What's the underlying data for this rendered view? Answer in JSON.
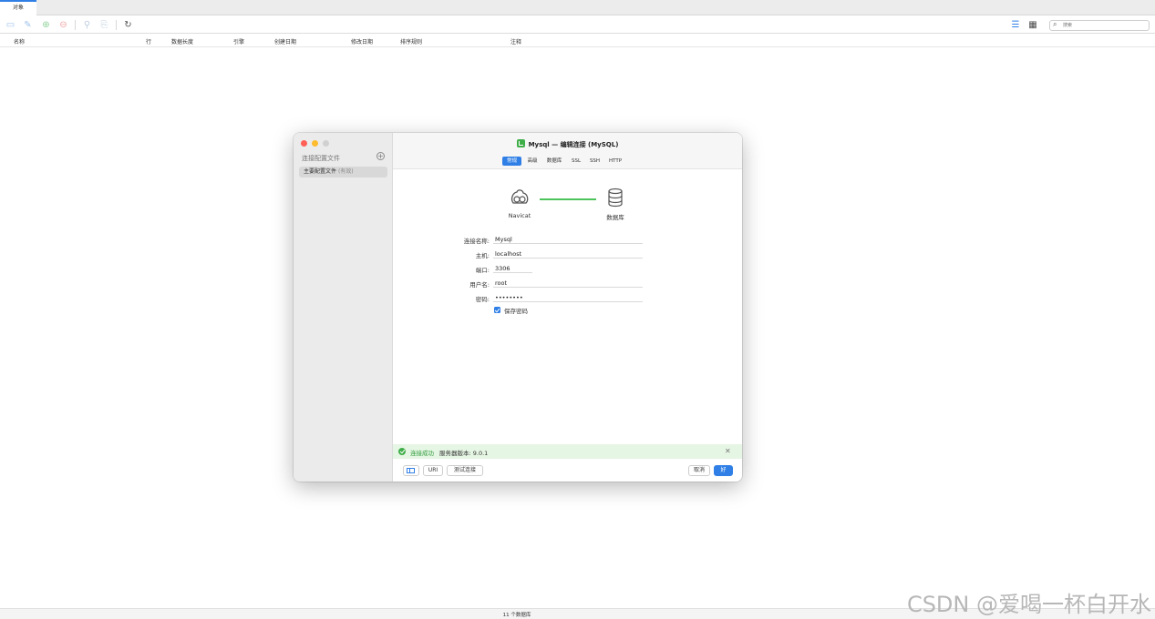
{
  "tabs": [
    {
      "label": "对象"
    }
  ],
  "columns": [
    "名称",
    "行",
    "数据长度",
    "引擎",
    "创建日期",
    "修改日期",
    "排序规则",
    "注释"
  ],
  "search": {
    "placeholder": "搜索"
  },
  "status": {
    "text": "11 个数据库"
  },
  "watermark": "CSDN @爱喝一杯白开水",
  "dialog": {
    "title": "Mysql — 编辑连接 (MySQL)",
    "sidebar": {
      "heading": "连接配置文件",
      "item_label": "主要配置文件",
      "item_tag": "(有效)"
    },
    "segments": [
      "常规",
      "高级",
      "数据库",
      "SSL",
      "SSH",
      "HTTP"
    ],
    "active_segment": "常规",
    "diagram": {
      "left_label": "Navicat",
      "right_label": "数据库"
    },
    "form": {
      "connection_name_label": "连接名称:",
      "connection_name": "Mysql",
      "host_label": "主机:",
      "host": "localhost",
      "port_label": "端口:",
      "port": "3306",
      "user_label": "用户名:",
      "user": "root",
      "password_label": "密码:",
      "password": "••••••••",
      "save_password_label": "保存密码",
      "save_password": true
    },
    "result": {
      "status": "连接成功",
      "version": "服务器版本: 9.0.1"
    },
    "buttons": {
      "uri": "URI",
      "test": "测试连接",
      "cancel": "取消",
      "ok": "好"
    }
  },
  "colors": {
    "accent": "#2f7fe6",
    "success": "#3fae49"
  }
}
